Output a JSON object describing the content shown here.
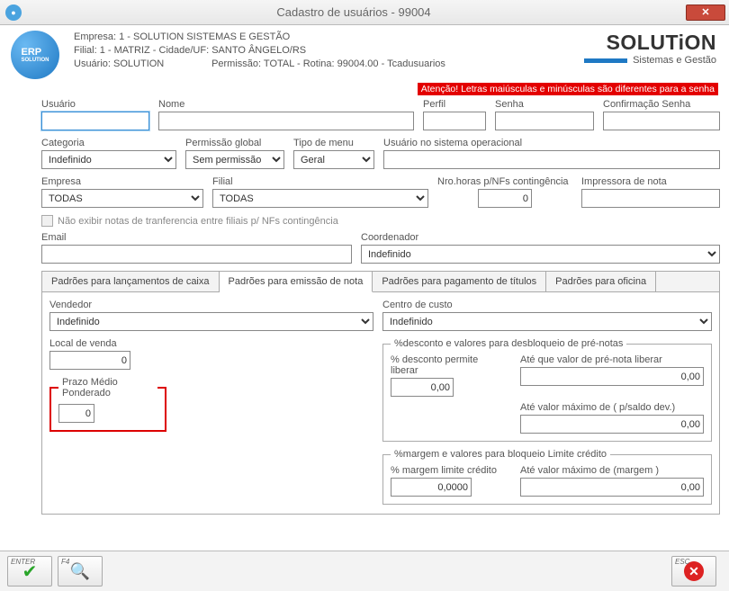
{
  "window": {
    "title": "Cadastro de usuários - 99004"
  },
  "header": {
    "line1": "Empresa: 1 - SOLUTION SISTEMAS E GESTÃO",
    "line2": "Filial: 1 - MATRIZ - Cidade/UF: SANTO ÂNGELO/RS",
    "line3_user_label": "Usuário: SOLUTION",
    "line3_perm": "Permissão: TOTAL - Rotina: 99004.00 - Tcadusuarios",
    "brand_main": "SOLUTiON",
    "brand_sub": "Sistemas e Gestão",
    "warning": "Atenção! Letras maiúsculas e minúsculas são diferentes para a senha"
  },
  "labels": {
    "usuario": "Usuário",
    "nome": "Nome",
    "perfil": "Perfil",
    "senha": "Senha",
    "conf_senha": "Confirmação Senha",
    "categoria": "Categoria",
    "perm_global": "Permissão global",
    "tipo_menu": "Tipo de menu",
    "usuario_so": "Usuário no sistema operacional",
    "empresa": "Empresa",
    "filial": "Filial",
    "horas_nfs": "Nro.horas p/NFs contingência",
    "impressora": "Impressora de nota",
    "nao_exibir": "Não exibir notas de tranferencia entre filiais p/ NFs contingência",
    "email": "Email",
    "coordenador": "Coordenador"
  },
  "values": {
    "categoria": "Indefinido",
    "perm_global": "Sem permissão",
    "tipo_menu": "Geral",
    "empresa": "TODAS",
    "filial": "TODAS",
    "horas_nfs": "0",
    "coordenador": "Indefinido"
  },
  "tabs": {
    "t1": "Padrões para lançamentos de caixa",
    "t2": "Padrões para emissão de nota",
    "t3": "Padrões para pagamento de títulos",
    "t4": "Padrões para oficina"
  },
  "tab2": {
    "vendedor_label": "Vendedor",
    "vendedor_value": "Indefinido",
    "centro_label": "Centro de custo",
    "centro_value": "Indefinido",
    "local_venda_label": "Local de venda",
    "local_venda_value": "0",
    "prazo_legend": "Prazo Médio Ponderado",
    "prazo_value": "0",
    "desc_legend": "%desconto e valores para desbloqueio de pré-notas",
    "desc_perc_label": "% desconto permite liberar",
    "desc_perc_value": "0,00",
    "ate_valor_label": "Até que valor de pré-nota liberar",
    "ate_valor_value": "0,00",
    "ate_max_label": "Até valor máximo de ( p/saldo dev.)",
    "ate_max_value": "0,00",
    "margem_legend": "%margem e valores para bloqueio Limite crédito",
    "margem_perc_label": "% margem limite crédito",
    "margem_perc_value": "0,0000",
    "margem_ate_label": "Até valor máximo de (margem )",
    "margem_ate_value": "0,00"
  },
  "footer": {
    "enter": "ENTER",
    "f4": "F4",
    "esc": "ESC"
  }
}
